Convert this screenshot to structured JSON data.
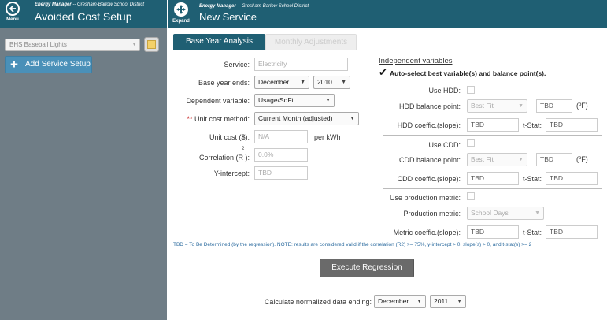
{
  "header": {
    "app_sub": "Energy Manager",
    "org": " -- Gresham-Barlow School District",
    "left_title": "Avoided Cost Setup",
    "main_title": "New Service",
    "menu_label": "Menu",
    "expand_label": "Expand"
  },
  "sidebar": {
    "selected_service": "BHS Baseball Lights",
    "add_button": "Add Service Setup"
  },
  "tabs": [
    {
      "label": "Base Year Analysis",
      "active": true
    },
    {
      "label": "Monthly Adjustments",
      "active": false
    }
  ],
  "form": {
    "service_label": "Service:",
    "service_value": "Electricity",
    "base_year_label": "Base year ends:",
    "base_month": "December",
    "base_year": "2010",
    "dependent_label": "Dependent variable:",
    "dependent_value": "Usage/SqFt",
    "unit_method_stars": "**",
    "unit_method_label": " Unit cost method:",
    "unit_method_value": "Current Month (adjusted)",
    "unit_cost_label": "Unit cost ($):",
    "unit_cost_value": "N/A",
    "unit_cost_suffix": "per kWh",
    "correlation_label": "Correlation (R ):",
    "correlation_sup": "2",
    "correlation_value": "0.0%",
    "intercept_label": "Y-intercept:",
    "intercept_value": "TBD"
  },
  "independent": {
    "title": "Independent variables",
    "auto_select": "Auto-select best variable(s) and balance point(s).",
    "use_hdd": "Use HDD:",
    "hdd_bp_label": "HDD balance point:",
    "hdd_bp_select": "Best Fit",
    "hdd_bp_value": "TBD",
    "hdd_unit": "(ºF)",
    "hdd_coef_label": "HDD coeffic.(slope):",
    "hdd_coef_value": "TBD",
    "hdd_tstat_label": "t-Stat:",
    "hdd_tstat_value": "TBD",
    "use_cdd": "Use CDD:",
    "cdd_bp_label": "CDD balance point:",
    "cdd_bp_select": "Best Fit",
    "cdd_bp_value": "TBD",
    "cdd_unit": "(ºF)",
    "cdd_coef_label": "CDD coeffic.(slope):",
    "cdd_coef_value": "TBD",
    "cdd_tstat_label": "t-Stat:",
    "cdd_tstat_value": "TBD",
    "use_prod": "Use production metric:",
    "prod_label": "Production metric:",
    "prod_select": "School Days",
    "metric_coef_label": "Metric coeffic.(slope):",
    "metric_coef_value": "TBD",
    "metric_tstat_label": "t-Stat:",
    "metric_tstat_value": "TBD"
  },
  "footer": {
    "note": "TBD = To Be Determined (by the regression). NOTE: results are considered valid if the correlation (R2) >= 75%, y-intercept > 0, slope(s) > 0, and t-stat(s) >= 2",
    "execute_button": "Execute Regression",
    "normalized_label": "Calculate normalized data ending:",
    "norm_month": "December",
    "norm_year": "2011"
  },
  "colors": {
    "header": "#1f5f73",
    "sidebar": "#6f7d86",
    "add_button": "#4a90b8",
    "execute_button": "#6a6a6a"
  }
}
